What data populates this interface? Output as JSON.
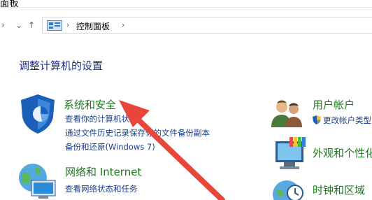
{
  "window": {
    "title_partial": "面板"
  },
  "address": {
    "crumb": "控制面板"
  },
  "page": {
    "heading": "调整计算机的设置"
  },
  "categories": [
    {
      "title": "系统和安全",
      "links": [
        "查看你的计算机状态",
        "通过文件历史记录保存你的文件备份副本",
        "备份和还原(Windows 7)"
      ]
    },
    {
      "title": "网络和 Internet",
      "links": [
        "查看网络状态和任务"
      ]
    },
    {
      "title": "用户帐户",
      "links": [
        "更改帐户类型"
      ]
    },
    {
      "title": "外观和个性化",
      "links": []
    },
    {
      "title": "时钟和区域",
      "links": []
    }
  ],
  "annotation": {
    "arrow_color": "#e8463a"
  }
}
